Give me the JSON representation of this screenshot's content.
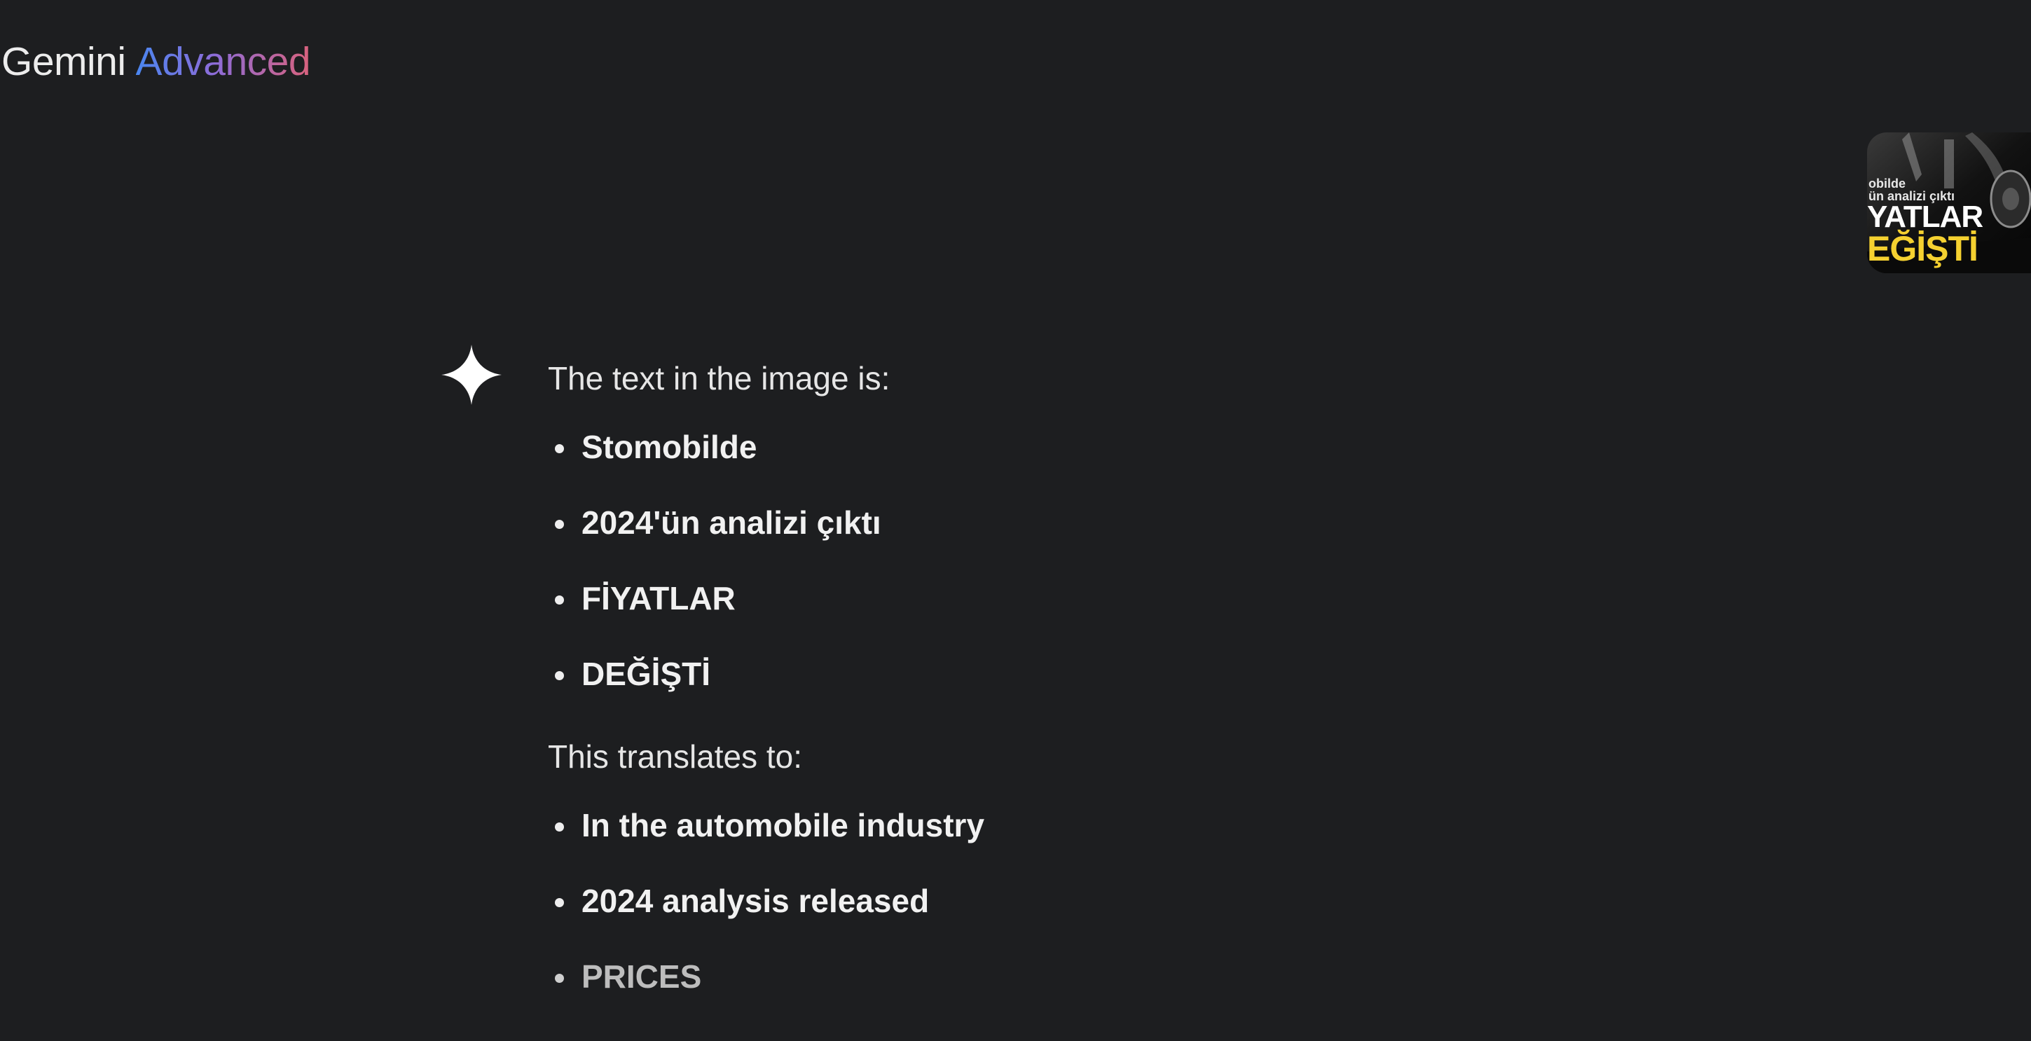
{
  "brand": {
    "name": "Gemini",
    "tier": "Advanced"
  },
  "upload_thumbnail": {
    "icon": "uploaded-image-thumbnail",
    "lines": [
      "obilde",
      "ün analizi çıktı",
      "YATLAR",
      "EĞİŞTİ"
    ],
    "accent_color": "#f5d130"
  },
  "response": {
    "icon": "gemini-spark-icon",
    "intro": "The text in the image is:",
    "original_items": [
      "Stomobilde",
      "2024'ün analizi çıktı",
      "FİYATLAR",
      "DEĞİŞTİ"
    ],
    "translation_intro": "This translates to:",
    "translated_items": [
      "In the automobile industry",
      "2024 analysis released",
      "PRICES"
    ]
  }
}
